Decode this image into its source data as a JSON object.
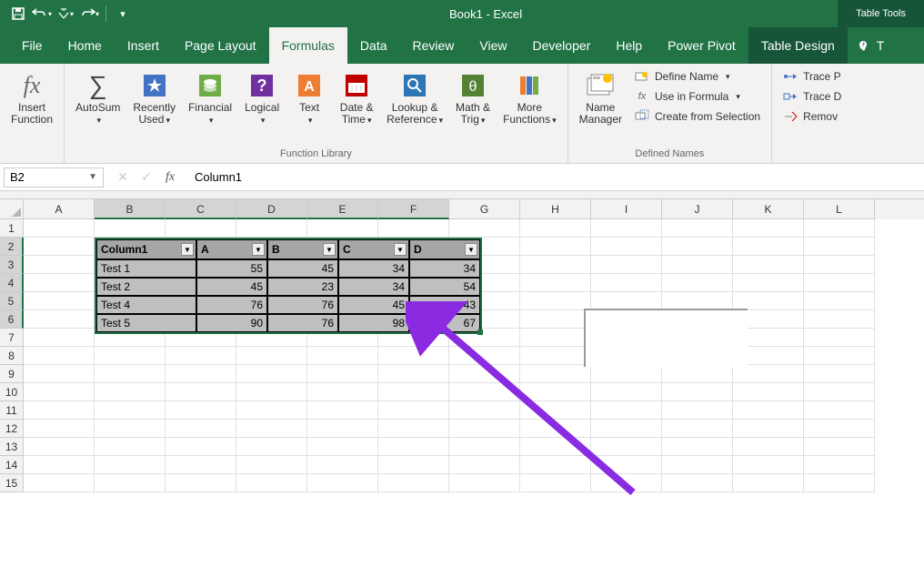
{
  "title": "Book1 - Excel",
  "contextual_tab_header": "Table Tools",
  "tabs": [
    "File",
    "Home",
    "Insert",
    "Page Layout",
    "Formulas",
    "Data",
    "Review",
    "View",
    "Developer",
    "Help",
    "Power Pivot",
    "Table Design"
  ],
  "active_tab": "Formulas",
  "ribbon": {
    "insert_function": "Insert\nFunction",
    "autosum": "AutoSum",
    "recently_used": "Recently\nUsed",
    "financial": "Financial",
    "logical": "Logical",
    "text": "Text",
    "date_time": "Date &\nTime",
    "lookup_ref": "Lookup &\nReference",
    "math_trig": "Math &\nTrig",
    "more_functions": "More\nFunctions",
    "function_library": "Function Library",
    "name_manager": "Name\nManager",
    "define_name": "Define Name",
    "use_in_formula": "Use in Formula",
    "create_from_selection": "Create from Selection",
    "defined_names": "Defined Names",
    "trace_p": "Trace P",
    "trace_d": "Trace D",
    "remov": "Remov"
  },
  "name_box": "B2",
  "formula_bar": "Column1",
  "columns": [
    "A",
    "B",
    "C",
    "D",
    "E",
    "F",
    "G",
    "H",
    "I",
    "J",
    "K",
    "L"
  ],
  "rows": [
    "1",
    "2",
    "3",
    "4",
    "5",
    "6",
    "7",
    "8",
    "9",
    "10",
    "11",
    "12",
    "13",
    "14",
    "15"
  ],
  "table": {
    "headers": [
      "Column1",
      "A",
      "B",
      "C",
      "D"
    ],
    "data": [
      [
        "Test 1",
        "55",
        "45",
        "34",
        "34"
      ],
      [
        "Test 2",
        "45",
        "23",
        "34",
        "54"
      ],
      [
        "Test 4",
        "76",
        "76",
        "45",
        "43"
      ],
      [
        "Test 5",
        "90",
        "76",
        "98",
        "67"
      ]
    ]
  }
}
